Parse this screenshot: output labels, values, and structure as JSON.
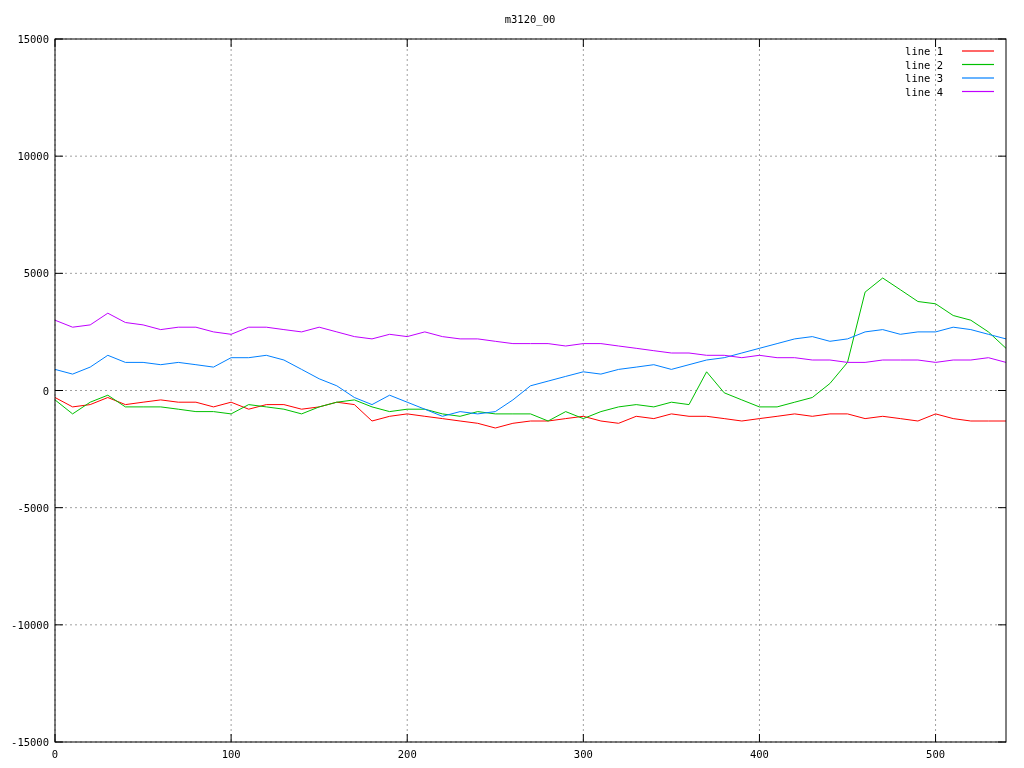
{
  "chart_data": {
    "type": "line",
    "title": "m3120_00",
    "grid": true,
    "legend": true,
    "xlim": [
      0,
      540
    ],
    "ylim": [
      -15000,
      15000
    ],
    "xticks": [
      0,
      100,
      200,
      300,
      400,
      500
    ],
    "yticks": [
      -15000,
      -10000,
      -5000,
      0,
      5000,
      10000,
      15000
    ],
    "x": [
      0,
      10,
      20,
      30,
      40,
      50,
      60,
      70,
      80,
      90,
      100,
      110,
      120,
      130,
      140,
      150,
      160,
      170,
      180,
      190,
      200,
      210,
      220,
      230,
      240,
      250,
      260,
      270,
      280,
      290,
      300,
      310,
      320,
      330,
      340,
      350,
      360,
      370,
      380,
      390,
      400,
      410,
      420,
      430,
      440,
      450,
      460,
      470,
      480,
      490,
      500,
      510,
      520,
      530,
      540
    ],
    "series": [
      {
        "name": "line 1",
        "color": "#ff0000",
        "values": [
          -300,
          -700,
          -600,
          -300,
          -600,
          -500,
          -400,
          -500,
          -500,
          -700,
          -500,
          -800,
          -600,
          -600,
          -800,
          -700,
          -500,
          -600,
          -1300,
          -1100,
          -1000,
          -1100,
          -1200,
          -1300,
          -1400,
          -1600,
          -1400,
          -1300,
          -1300,
          -1200,
          -1100,
          -1300,
          -1400,
          -1100,
          -1200,
          -1000,
          -1100,
          -1100,
          -1200,
          -1300,
          -1200,
          -1100,
          -1000,
          -1100,
          -1000,
          -1000,
          -1200,
          -1100,
          -1200,
          -1300,
          -1000,
          -1200,
          -1300,
          -1300,
          -1300
        ]
      },
      {
        "name": "line 2",
        "color": "#00c000",
        "values": [
          -400,
          -1000,
          -500,
          -200,
          -700,
          -700,
          -700,
          -800,
          -900,
          -900,
          -1000,
          -600,
          -700,
          -800,
          -1000,
          -700,
          -500,
          -400,
          -700,
          -900,
          -800,
          -800,
          -1000,
          -1100,
          -900,
          -1000,
          -1000,
          -1000,
          -1300,
          -900,
          -1200,
          -900,
          -700,
          -600,
          -700,
          -500,
          -600,
          800,
          -100,
          -400,
          -700,
          -700,
          -500,
          -300,
          300,
          1200,
          4200,
          4800,
          4300,
          3800,
          3700,
          3200,
          3000,
          2500,
          1800
        ]
      },
      {
        "name": "line 3",
        "color": "#0080ff",
        "values": [
          900,
          700,
          1000,
          1500,
          1200,
          1200,
          1100,
          1200,
          1100,
          1000,
          1400,
          1400,
          1500,
          1300,
          900,
          500,
          200,
          -300,
          -600,
          -200,
          -500,
          -800,
          -1100,
          -900,
          -1000,
          -900,
          -400,
          200,
          400,
          600,
          800,
          700,
          900,
          1000,
          1100,
          900,
          1100,
          1300,
          1400,
          1600,
          1800,
          2000,
          2200,
          2300,
          2100,
          2200,
          2500,
          2600,
          2400,
          2500,
          2500,
          2700,
          2600,
          2400,
          2200
        ]
      },
      {
        "name": "line 4",
        "color": "#c000ff",
        "values": [
          3000,
          2700,
          2800,
          3300,
          2900,
          2800,
          2600,
          2700,
          2700,
          2500,
          2400,
          2700,
          2700,
          2600,
          2500,
          2700,
          2500,
          2300,
          2200,
          2400,
          2300,
          2500,
          2300,
          2200,
          2200,
          2100,
          2000,
          2000,
          2000,
          1900,
          2000,
          2000,
          1900,
          1800,
          1700,
          1600,
          1600,
          1500,
          1500,
          1400,
          1500,
          1400,
          1400,
          1300,
          1300,
          1200,
          1200,
          1300,
          1300,
          1300,
          1200,
          1300,
          1300,
          1400,
          1200
        ]
      }
    ]
  }
}
